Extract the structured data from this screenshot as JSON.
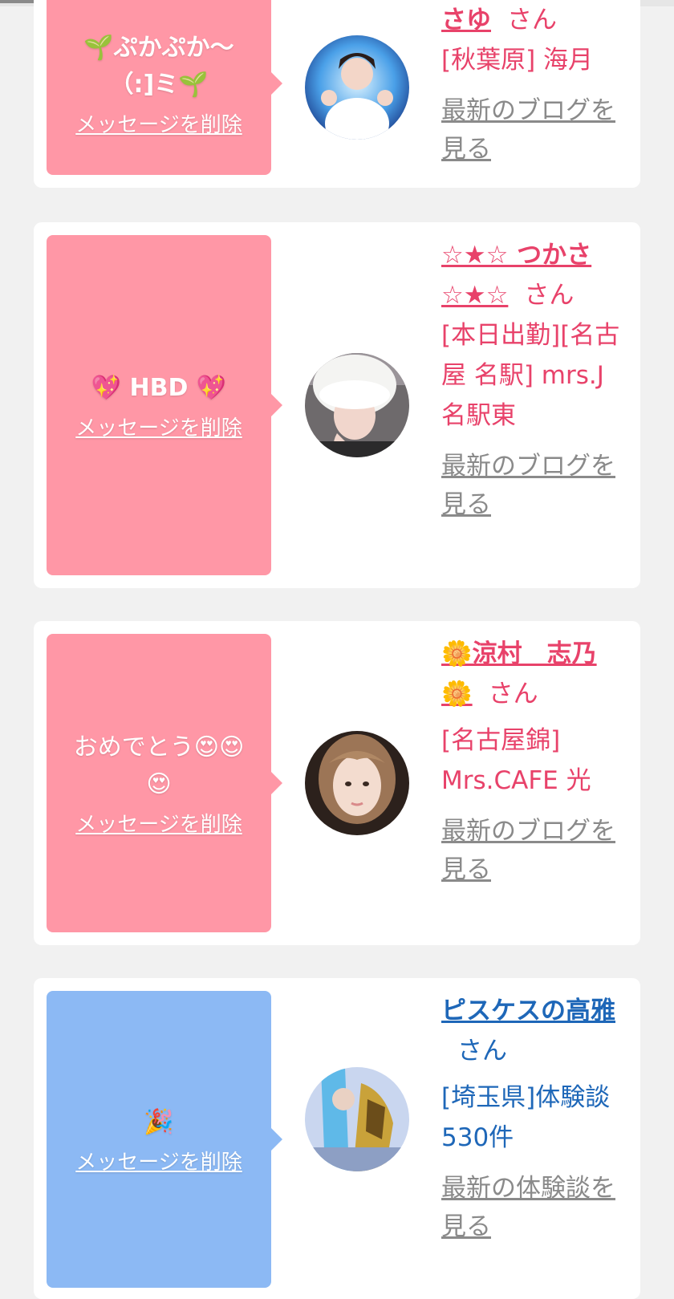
{
  "cards": [
    {
      "message_text": "🌱ぷかぷか〜（:]ミ🌱",
      "delete_label": "メッセージを削除",
      "name": "さゆ",
      "san": "さん",
      "shop": "[秋葉原] 海月",
      "blog_link": "最新のブログを見る",
      "theme": "pink"
    },
    {
      "message_text": "💖 HBD 💖",
      "delete_label": "メッセージを削除",
      "name": "☆★☆ つかさ ☆★☆",
      "san": "さん",
      "shop": "[本日出勤][名古屋 名駅] mrs.J 名駅東",
      "blog_link": "最新のブログを見る",
      "theme": "pink"
    },
    {
      "message_text": "おめでとう😍😍😍",
      "delete_label": "メッセージを削除",
      "name": "🌼涼村　志乃🌼",
      "san": "さん",
      "shop": "[名古屋錦] Mrs.CAFE 光",
      "blog_link": "最新のブログを見る",
      "theme": "pink"
    },
    {
      "message_text": "🎉",
      "delete_label": "メッセージを削除",
      "name": "ピスケスの高雅",
      "san": "さん",
      "shop": "[埼玉県]体験談 530件",
      "blog_link": "最新の体験談を見る",
      "theme": "blue"
    }
  ],
  "colors": {
    "pink_bubble": "#ff97a6",
    "blue_bubble": "#8cb9f4",
    "pink_name": "#e8426a",
    "blue_name": "#1e67b8",
    "link_gray": "#8a8a8a"
  }
}
